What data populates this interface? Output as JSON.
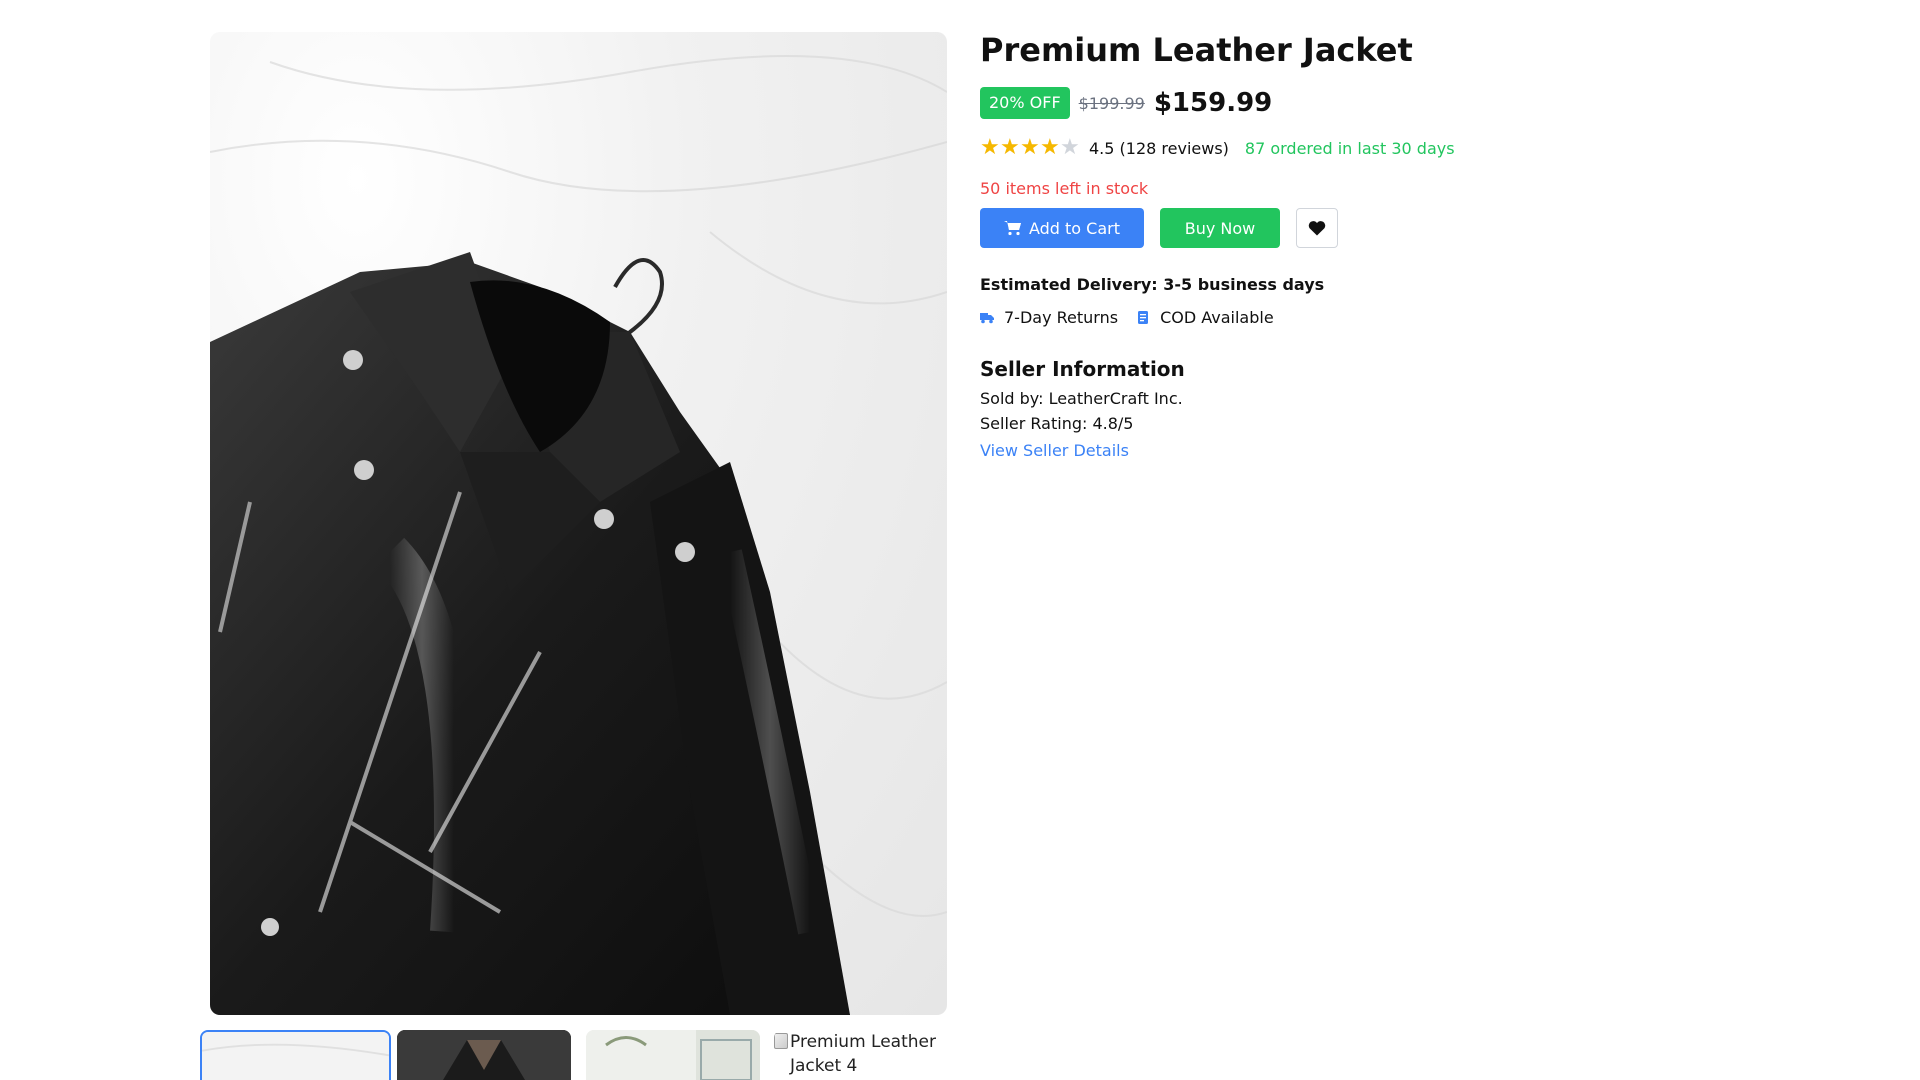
{
  "product": {
    "title": "Premium Leather Jacket",
    "discount_badge": "20% OFF",
    "original_price": "$199.99",
    "sale_price": "$159.99",
    "rating_value": 4.5,
    "rating_text": "4.5 (128 reviews)",
    "ordered_text": "87 ordered in last 30 days",
    "stock_text": "50 items left in stock"
  },
  "gallery": {
    "main_image_alt": "Premium Leather Jacket",
    "thumbnails": [
      {
        "alt": "Premium Leather Jacket 1",
        "selected": true
      },
      {
        "alt": "Premium Leather Jacket 2",
        "selected": false
      },
      {
        "alt": "Premium Leather Jacket 3",
        "selected": false
      },
      {
        "alt": "Premium Leather Jacket 4",
        "selected": false
      }
    ],
    "broken_thumb_text": "Premium Leather Jacket 4"
  },
  "actions": {
    "add_to_cart": "Add to Cart",
    "buy_now": "Buy Now",
    "wishlist_icon": "heart-icon"
  },
  "delivery": {
    "estimate": "Estimated Delivery: 3-5 business days",
    "features": [
      {
        "icon": "truck-icon",
        "label": "7-Day Returns"
      },
      {
        "icon": "receipt-icon",
        "label": "COD Available"
      }
    ]
  },
  "seller": {
    "heading": "Seller Information",
    "sold_by": "Sold by: LeatherCraft Inc.",
    "rating": "Seller Rating: 4.8/5",
    "link": "View Seller Details"
  },
  "colors": {
    "accent_blue": "#3b82f6",
    "accent_green": "#22c55e",
    "alert_red": "#ef4444",
    "star_gold": "#f5b800"
  }
}
